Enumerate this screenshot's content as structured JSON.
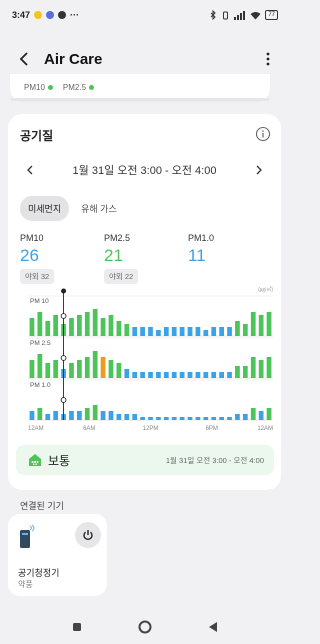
{
  "statusbar": {
    "time": "3:47",
    "notif_more": "···",
    "battery": "77"
  },
  "header": {
    "title": "Air Care"
  },
  "top_card": {
    "item1": "PM10",
    "item2": "PM2.5"
  },
  "card": {
    "title": "공기질",
    "date_range": "1월 31일 오전 3:00 - 오전 4:00",
    "tabs": [
      {
        "label": "미세먼지"
      },
      {
        "label": "유해 가스"
      }
    ],
    "metrics": [
      {
        "label": "PM10",
        "value": "26",
        "outdoor": "야외 32",
        "color": "#3aa3e8"
      },
      {
        "label": "PM2.5",
        "value": "21",
        "outdoor": "야외 22",
        "color": "#4cc45a"
      },
      {
        "label": "PM1.0",
        "value": "11",
        "outdoor": "",
        "color": "#3aa3e8"
      }
    ],
    "status": {
      "label": "보통",
      "time": "1월 31일 오전 3:00 - 오전 4:00",
      "color": "#4cc45a"
    }
  },
  "chart_data": {
    "type": "bar",
    "unit": "(㎍/㎥)",
    "x_ticks": [
      "12AM",
      "6AM",
      "12PM",
      "6PM",
      "12AM"
    ],
    "series": [
      {
        "name": "PM 10",
        "values": [
          6,
          8,
          5,
          7,
          4,
          6,
          7,
          8,
          9,
          6,
          7,
          5,
          4,
          3,
          3,
          3,
          2,
          3,
          3,
          3,
          3,
          3,
          2,
          3,
          3,
          3,
          5,
          4,
          8,
          7,
          8
        ]
      },
      {
        "name": "PM 2.5",
        "values": [
          6,
          8,
          5,
          6,
          3,
          5,
          6,
          7,
          9,
          7,
          6,
          5,
          3,
          2,
          2,
          2,
          2,
          2,
          2,
          2,
          2,
          2,
          2,
          2,
          2,
          2,
          4,
          4,
          7,
          6,
          7
        ]
      },
      {
        "name": "PM 1.0",
        "values": [
          3,
          4,
          2,
          3,
          2,
          3,
          3,
          4,
          5,
          3,
          3,
          2,
          2,
          2,
          1,
          1,
          1,
          1,
          1,
          1,
          1,
          1,
          1,
          1,
          1,
          1,
          2,
          2,
          4,
          3,
          4
        ]
      }
    ],
    "highlight_index": 9,
    "colors": {
      "green": "#4cc45a",
      "blue": "#3aa3e8",
      "orange": "#f29a1c"
    }
  },
  "connected": {
    "title": "연결된 기기",
    "device_name": "공기청정기",
    "device_status": "약풍"
  },
  "icons": {
    "back": "arrow-left-icon",
    "more": "more-vert-icon",
    "info": "info-icon",
    "status": "air-quality-icon",
    "power": "power-icon",
    "device": "air-purifier-icon"
  }
}
